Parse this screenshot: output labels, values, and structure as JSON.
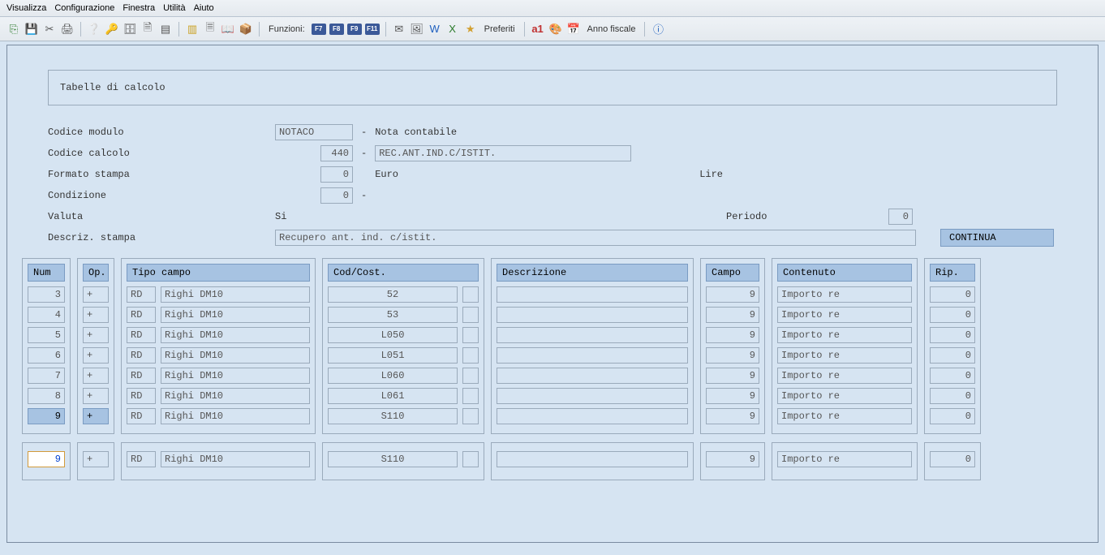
{
  "menu": {
    "items": [
      "Visualizza",
      "Configurazione",
      "Finestra",
      "Utilità",
      "Aiuto"
    ]
  },
  "toolbar": {
    "funzioni_label": "Funzioni:",
    "fkeys": [
      "F7",
      "F8",
      "F9",
      "F11"
    ],
    "preferiti": "Preferiti",
    "anno": "Anno fiscale"
  },
  "title": "Tabelle di calcolo",
  "form": {
    "codice_modulo_label": "Codice modulo",
    "codice_modulo_val": "NOTACO",
    "codice_modulo_desc": "Nota contabile",
    "codice_calcolo_label": "Codice calcolo",
    "codice_calcolo_val": "440",
    "codice_calcolo_desc": "REC.ANT.IND.C/ISTIT.",
    "formato_label": "Formato stampa",
    "formato_val": "0",
    "formato_euro": "Euro",
    "formato_lire": "Lire",
    "condizione_label": "Condizione",
    "condizione_val": "0",
    "valuta_label": "Valuta",
    "valuta_val": "Si",
    "periodo_label": "Periodo",
    "periodo_val": "0",
    "descriz_label": "Descriz. stampa",
    "descriz_val": "Recupero ant. ind. c/istit.",
    "continua": "CONTINUA"
  },
  "grid": {
    "headers": {
      "num": "Num",
      "op": "Op.",
      "tipo": "Tipo campo",
      "cod": "Cod/Cost.",
      "desc": "Descrizione",
      "campo": "Campo",
      "cont": "Contenuto",
      "rip": "Rip."
    },
    "rows": [
      {
        "num": "3",
        "op": "+",
        "tc": "RD",
        "td": "Righi DM10",
        "cod": "52",
        "desc": "",
        "campo": "9",
        "cont": "Importo re",
        "rip": "0"
      },
      {
        "num": "4",
        "op": "+",
        "tc": "RD",
        "td": "Righi DM10",
        "cod": "53",
        "desc": "",
        "campo": "9",
        "cont": "Importo re",
        "rip": "0"
      },
      {
        "num": "5",
        "op": "+",
        "tc": "RD",
        "td": "Righi DM10",
        "cod": "L050",
        "desc": "",
        "campo": "9",
        "cont": "Importo re",
        "rip": "0"
      },
      {
        "num": "6",
        "op": "+",
        "tc": "RD",
        "td": "Righi DM10",
        "cod": "L051",
        "desc": "",
        "campo": "9",
        "cont": "Importo re",
        "rip": "0"
      },
      {
        "num": "7",
        "op": "+",
        "tc": "RD",
        "td": "Righi DM10",
        "cod": "L060",
        "desc": "",
        "campo": "9",
        "cont": "Importo re",
        "rip": "0"
      },
      {
        "num": "8",
        "op": "+",
        "tc": "RD",
        "td": "Righi DM10",
        "cod": "L061",
        "desc": "",
        "campo": "9",
        "cont": "Importo re",
        "rip": "0"
      },
      {
        "num": "9",
        "op": "+",
        "tc": "RD",
        "td": "Righi DM10",
        "cod": "S110",
        "desc": "",
        "campo": "9",
        "cont": "Importo re",
        "rip": "0",
        "hi": true
      }
    ],
    "edit": {
      "num": "9",
      "op": "+",
      "tc": "RD",
      "td": "Righi DM10",
      "cod": "S110",
      "desc": "",
      "campo": "9",
      "cont": "Importo re",
      "rip": "0"
    }
  }
}
